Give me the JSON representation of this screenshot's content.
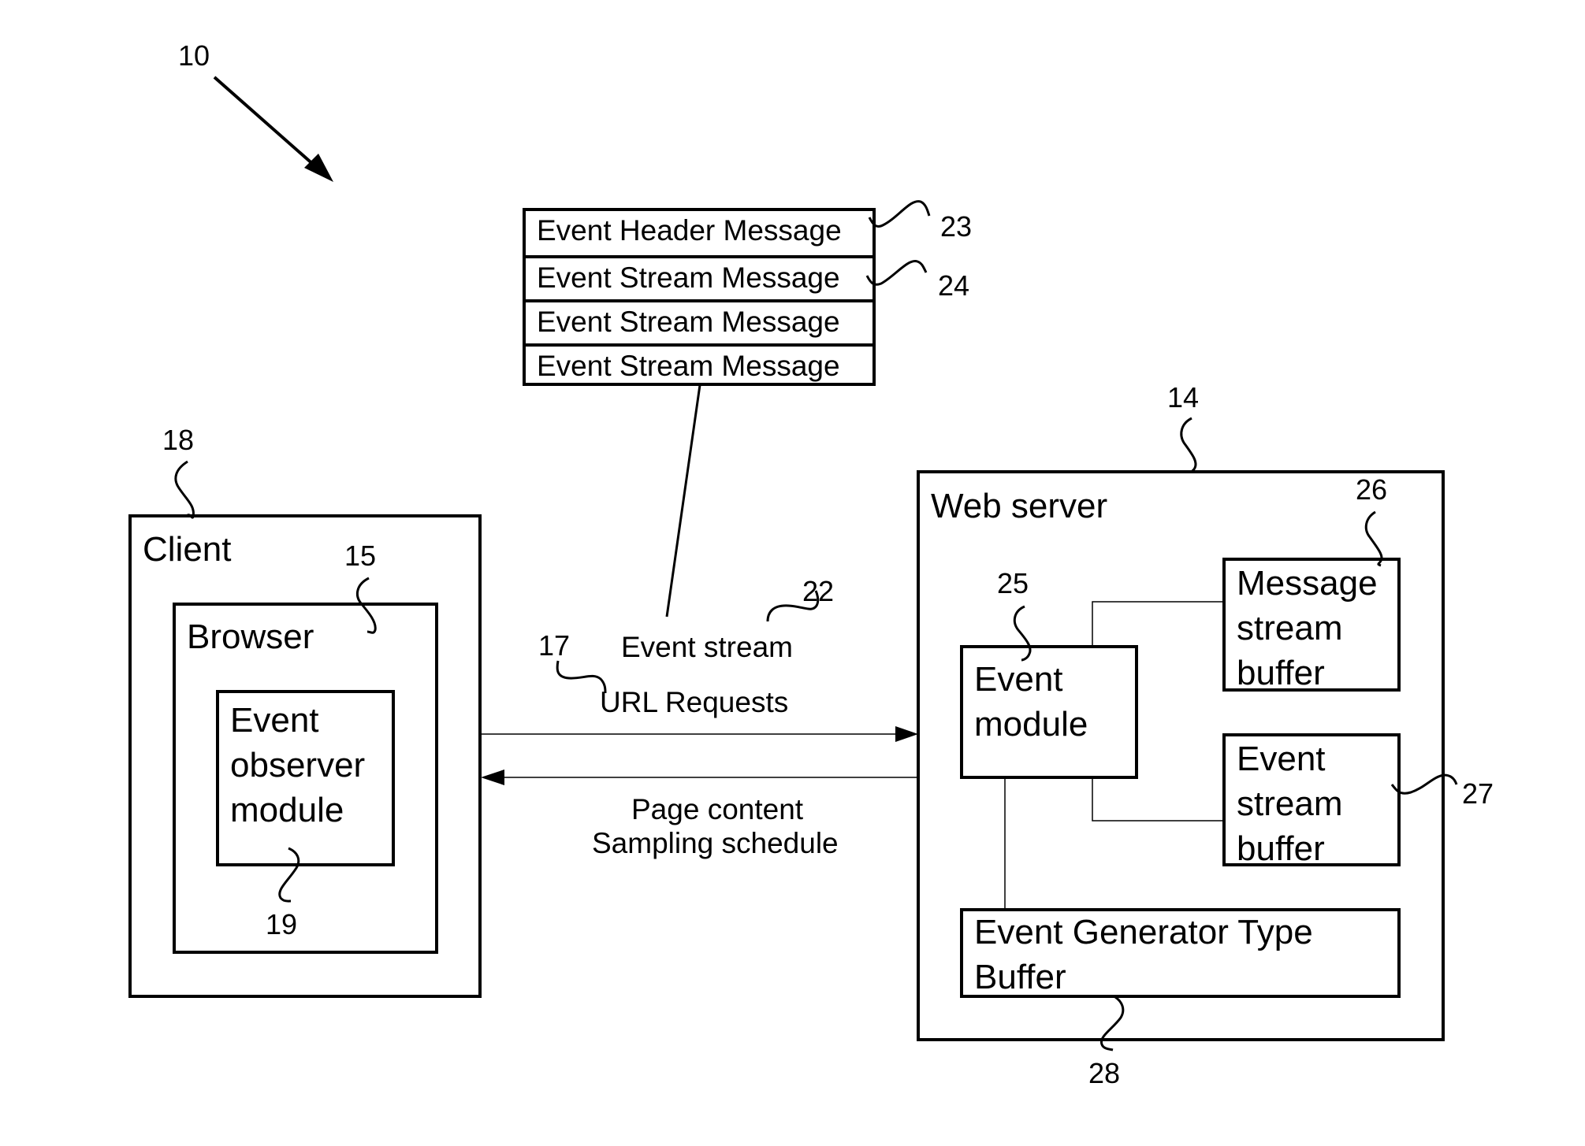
{
  "figure": {
    "ref_numeral": "10"
  },
  "message_stack": {
    "rows": [
      {
        "label": "Event Header Message"
      },
      {
        "label": "Event Stream Message"
      },
      {
        "label": "Event Stream Message"
      },
      {
        "label": "Event Stream Message"
      }
    ],
    "header_ref": "23",
    "stream_ref": "24"
  },
  "client": {
    "title": "Client",
    "ref": "18",
    "browser": {
      "title": "Browser",
      "ref": "15",
      "event_observer": {
        "label": "Event observer module",
        "ref": "19"
      }
    }
  },
  "links": {
    "event_stream_label": "Event stream",
    "event_stream_ref": "22",
    "url_requests_label": "URL Requests",
    "url_requests_ref": "17",
    "response_line1": "Page content",
    "response_line2": "Sampling schedule"
  },
  "web_server": {
    "title": "Web server",
    "ref": "14",
    "event_module": {
      "label": "Event module",
      "ref": "25"
    },
    "message_stream_buffer": {
      "label": "Message stream buffer",
      "ref": "26"
    },
    "event_stream_buffer": {
      "label": "Event stream buffer",
      "ref": "27"
    },
    "event_generator_type_buffer": {
      "label": "Event Generator Type Buffer",
      "ref": "28"
    }
  }
}
